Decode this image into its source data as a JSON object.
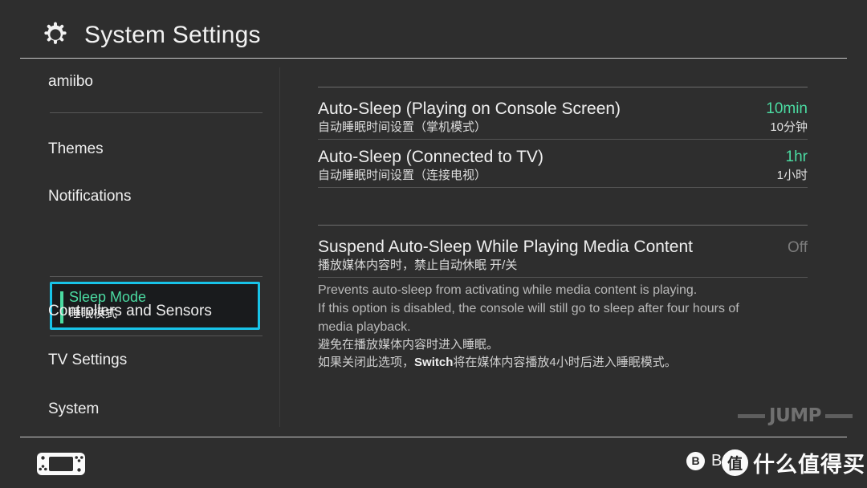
{
  "header": {
    "title": "System Settings",
    "icon": "gear-icon"
  },
  "sidebar": {
    "items": [
      {
        "label": "amiibo"
      },
      {
        "label": "Themes"
      },
      {
        "label": "Notifications"
      },
      {
        "label": "Sleep Mode",
        "label_zh": "睡眠模式",
        "selected": true
      },
      {
        "label": "Controllers and Sensors"
      },
      {
        "label": "TV Settings"
      },
      {
        "label": "System"
      }
    ]
  },
  "content": {
    "rows": [
      {
        "title": "Auto-Sleep (Playing on Console Screen)",
        "title_zh": "自动睡眠时间设置（掌机模式）",
        "value": "10min",
        "value_zh": "10分钟"
      },
      {
        "title": "Auto-Sleep (Connected to TV)",
        "title_zh": "自动睡眠时间设置（连接电视）",
        "value": "1hr",
        "value_zh": "1小时"
      },
      {
        "title": "Suspend Auto-Sleep While Playing Media Content",
        "title_zh": "播放媒体内容时，禁止自动休眠 开/关",
        "value": "Off"
      }
    ],
    "description": {
      "en_line1": "Prevents auto-sleep from activating while media content is playing.",
      "en_line2": "If this option is disabled, the console will still go to sleep after four hours of",
      "en_line3": "media playback.",
      "zh_line1": "避免在播放媒体内容时进入睡眠。",
      "zh_line2_prefix": "如果关闭此选项，",
      "zh_line2_bold": "Switch",
      "zh_line2_suffix": "将在媒体内容播放4小时后进入睡眠模式。"
    }
  },
  "bottom_bar": {
    "console_icon": "switch-console-icon",
    "back_button_glyph": "B",
    "back_label": "Back"
  },
  "watermarks": {
    "jump": "JUMP",
    "smzdm_logo": "值",
    "smzdm_text": "什么值得买"
  },
  "colors": {
    "accent_cyan": "#18c3e8",
    "accent_green": "#4bdba2",
    "background": "#2e2e2e",
    "text_primary": "#f0f0f0",
    "text_muted": "#7c7c7c"
  }
}
